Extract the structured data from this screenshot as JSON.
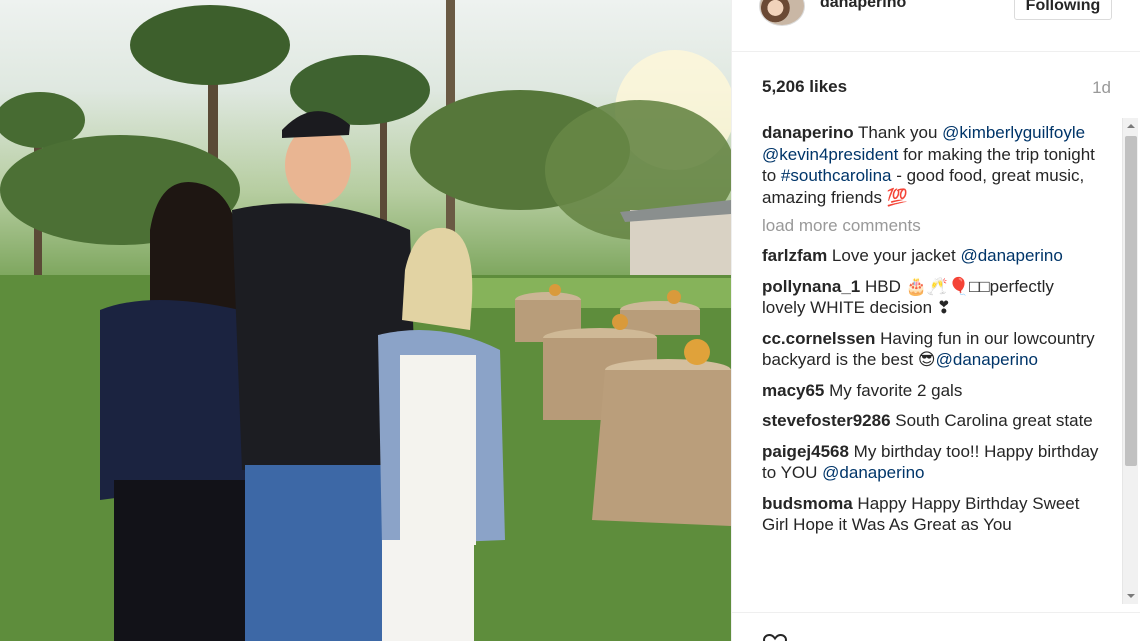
{
  "post": {
    "username": "danaperino",
    "follow_label": "Following",
    "likes": "5,206 likes",
    "time_ago": "1d",
    "load_more": "load more comments"
  },
  "caption": {
    "user": "danaperino",
    "text_1": " Thank you",
    "mention_1": "@kimberlyguilfoyle",
    "mention_2": " @kevin4president",
    "text_2": " for making the trip tonight to ",
    "hashtag": "#southcarolina",
    "text_3": " - good food, great music, amazing friends 💯"
  },
  "comments": [
    {
      "user": "farlzfam",
      "text": " Love your jacket ",
      "mention": "@danaperino",
      "text_after": ""
    },
    {
      "user": "pollynana_1",
      "text": " HBD 🎂🥂🎈□□perfectly lovely WHITE decision ❣",
      "mention": "",
      "text_after": ""
    },
    {
      "user": "cc.cornelssen",
      "text": " Having fun in our lowcountry backyard is the best 😎",
      "mention": "@danaperino",
      "text_after": ""
    },
    {
      "user": "macy65",
      "text": " My favorite 2 gals",
      "mention": "",
      "text_after": ""
    },
    {
      "user": "stevefoster9286",
      "text": " South Carolina great state",
      "mention": "",
      "text_after": ""
    },
    {
      "user": "paigej4568",
      "text": " My birthday too!! Happy birthday to YOU ",
      "mention": "@danaperino",
      "text_after": ""
    },
    {
      "user": "budsmoma",
      "text": " Happy Happy Birthday Sweet Girl Hope it Was As Great as You",
      "mention": "",
      "text_after": ""
    }
  ],
  "colors": {
    "mention": "#003569",
    "muted": "#999999",
    "text": "#262626"
  },
  "icons": [
    "heart-icon"
  ]
}
